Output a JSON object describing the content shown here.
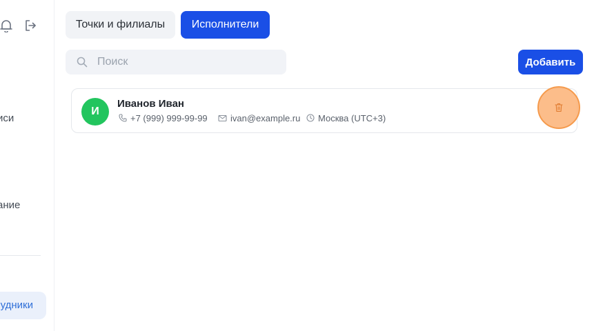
{
  "sidebar": {
    "partial_labels": [
      "иси",
      "ание"
    ],
    "active_item": "удники"
  },
  "tabs": [
    {
      "label": "Точки и филиалы",
      "active": false
    },
    {
      "label": "Исполнители",
      "active": true
    }
  ],
  "search": {
    "placeholder": "Поиск",
    "value": ""
  },
  "toolbar": {
    "add_label": "Добавить"
  },
  "performers": [
    {
      "initial": "И",
      "name": "Иванов Иван",
      "phone": "+7 (999) 999-99-99",
      "email": "ivan@example.ru",
      "timezone": "Москва (UTC+3)",
      "avatar_color": "#22c55e"
    }
  ],
  "colors": {
    "accent": "#1a4fe6",
    "active_sidebar_text": "#2f6fd8",
    "delete_highlight": "#f59a4c"
  },
  "icons": {
    "bell": "bell-icon",
    "logout": "logout-icon",
    "search": "search-icon",
    "phone": "phone-icon",
    "mail": "mail-icon",
    "clock": "clock-icon",
    "trash": "trash-icon"
  }
}
